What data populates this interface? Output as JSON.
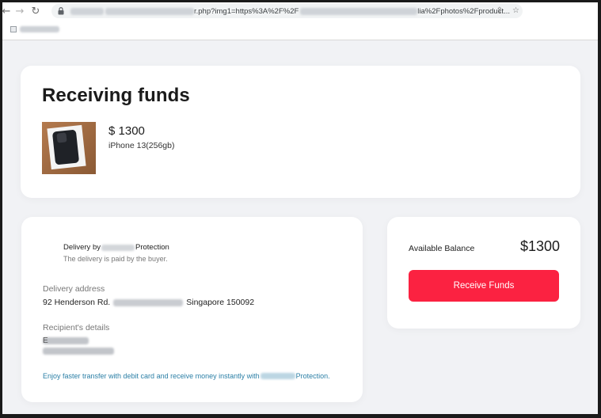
{
  "browser": {
    "back_glyph": "←",
    "forward_glyph": "→",
    "reload_glyph": "↻",
    "url_visible_part1": "r.php?img1=https%3A%2F%2F",
    "url_visible_part2": "lia%2Fphotos%2Fproduct...",
    "share_glyph": "⇪",
    "star_glyph": "☆"
  },
  "page": {
    "title": "Receiving funds",
    "product": {
      "price": "$ 1300",
      "name": "iPhone 13(256gb)"
    },
    "delivery": {
      "by_prefix": "Delivery by",
      "by_suffix": "Protection",
      "note": "The delivery is paid by the buyer.",
      "address_label": "Delivery address",
      "address_start": "92 Henderson Rd.",
      "address_end": "Singapore 150092",
      "recipient_label": "Recipient's details",
      "recipient_initial": "E",
      "promo_prefix": "Enjoy faster transfer with debit card and receive money instantly with",
      "promo_suffix": "Protection."
    },
    "balance": {
      "label": "Available Balance",
      "value": "$1300",
      "button_label": "Receive Funds"
    }
  },
  "colors": {
    "accent_button": "#fb2241",
    "promo_text": "#2b7fa6",
    "page_bg": "#f1f2f5"
  }
}
